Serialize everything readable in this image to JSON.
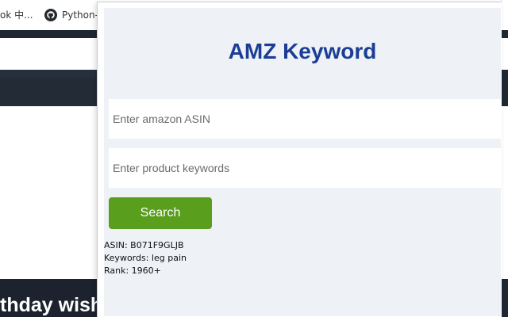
{
  "browser": {
    "bookmarks": [
      {
        "label": "ok 中..."
      },
      {
        "label": "Python-"
      }
    ],
    "page_heading_fragment": "thday wish"
  },
  "popup": {
    "title": "AMZ Keyword",
    "asin_input": {
      "placeholder": "Enter amazon ASIN",
      "value": ""
    },
    "keywords_input": {
      "placeholder": "Enter product keywords",
      "value": ""
    },
    "search_label": "Search",
    "results": {
      "asin": "ASIN: B071F9GLJB",
      "keywords": "Keywords: leg pain",
      "rank": "Rank: 1960+"
    }
  },
  "colors": {
    "title": "#1a3d95",
    "button": "#5a9e1e",
    "panel": "#eef1f6",
    "page_dark": "#262f3c"
  },
  "icons": {
    "bookmark_2": "github-icon"
  }
}
